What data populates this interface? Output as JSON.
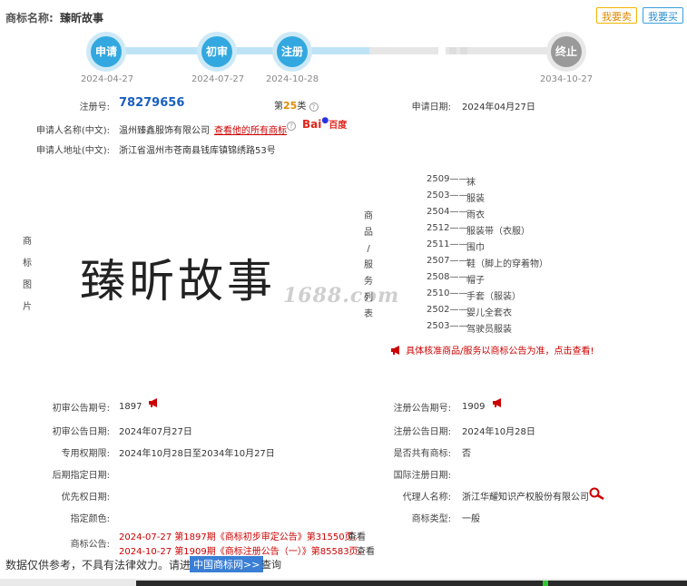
{
  "header": {
    "label": "商标名称:",
    "value": "臻昕故事",
    "sell_button": "我要卖",
    "buy_button": "我要买"
  },
  "timeline": [
    {
      "label": "申请",
      "date": "2024-04-27",
      "state": "done"
    },
    {
      "label": "初审",
      "date": "2024-07-27",
      "state": "done"
    },
    {
      "label": "注册",
      "date": "2024-10-28",
      "state": "done"
    },
    {
      "label": "终止",
      "date": "2034-10-27",
      "state": "future"
    }
  ],
  "info": {
    "reg_no_label": "注册号:",
    "reg_no": "78279656",
    "class_prefix": "第",
    "class_num": "25",
    "class_suffix": "类",
    "apply_date_label": "申请日期:",
    "apply_date": "2024年04月27日",
    "applicant_label": "申请人名称(中文):",
    "applicant": "温州臻鑫服饰有限公司",
    "all_marks_link": "查看他的所有商标",
    "baidu_bai": "Bai",
    "baidu_du": "百度",
    "address_label": "申请人地址(中文):",
    "address": "浙江省温州市苍南县钱库镇锦绣路53号"
  },
  "mark_image": {
    "side_label": [
      "商",
      "标",
      "图",
      "片"
    ],
    "text": "臻昕故事",
    "watermark": "1688.com"
  },
  "goods": {
    "side_label": [
      "商",
      "品",
      "/",
      "服",
      "务",
      "列",
      "表"
    ],
    "items": [
      {
        "code": "2509——",
        "name": "袜"
      },
      {
        "code": "2503——",
        "name": "服装"
      },
      {
        "code": "2504——",
        "name": "雨衣"
      },
      {
        "code": "2512——",
        "name": "服装带（衣服）"
      },
      {
        "code": "2511——",
        "name": "围巾"
      },
      {
        "code": "2507——",
        "name": "鞋（脚上的穿着物）"
      },
      {
        "code": "2508——",
        "name": "帽子"
      },
      {
        "code": "2510——",
        "name": "手套（服装）"
      },
      {
        "code": "2502——",
        "name": "婴儿全套衣"
      },
      {
        "code": "2503——",
        "name": "驾驶员服装"
      }
    ],
    "notice": "具体核准商品/服务以商标公告为准，点击查看!"
  },
  "details": {
    "prelim_no_label": "初审公告期号:",
    "prelim_no": "1897",
    "reg_notice_no_label": "注册公告期号:",
    "reg_notice_no": "1909",
    "prelim_date_label": "初审公告日期:",
    "prelim_date": "2024年07月27日",
    "reg_notice_date_label": "注册公告日期:",
    "reg_notice_date": "2024年10月28日",
    "excl_label": "专用权期限:",
    "excl_value": "2024年10月28日至2034年10月27日",
    "shared_label": "是否共有商标:",
    "shared_value": "否",
    "later_label": "后期指定日期:",
    "intl_label": "国际注册日期:",
    "priority_label": "优先权日期:",
    "agent_label": "代理人名称:",
    "agent_value": "浙江华耀知识产权股份有限公司",
    "color_label": "指定颜色:",
    "type_label": "商标类型:",
    "type_value": "一般",
    "announce_label": "商标公告:",
    "announce_1": "2024-07-27 第1897期《商标初步审定公告》第31550页。",
    "announce_2": "2024-10-27 第1909期《商标注册公告（一）》第85583页。",
    "view_label": "查看"
  },
  "footer": {
    "note": "数据仅供参考，不具有法律效力。请进入",
    "link": "中国商标网>>",
    "after": "查询"
  },
  "colors": {
    "accent_blue": "#33a8e0",
    "red": "#cc0000",
    "orange": "#e08a00"
  }
}
